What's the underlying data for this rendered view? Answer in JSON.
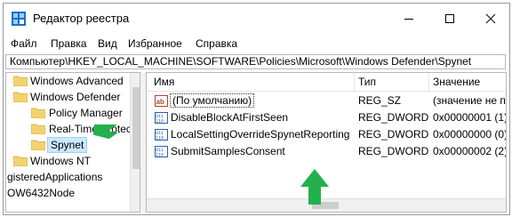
{
  "window": {
    "title": "Редактор реестра",
    "icon": "registry-editor-icon",
    "controls": [
      "minimize-icon",
      "maximize-icon",
      "close-icon"
    ]
  },
  "menu": [
    "Файл",
    "Правка",
    "Вид",
    "Избранное",
    "Справка"
  ],
  "address": "Компьютер\\HKEY_LOCAL_MACHINE\\SOFTWARE\\Policies\\Microsoft\\Windows Defender\\Spynet",
  "tree": [
    {
      "label": "Windows Advanced"
    },
    {
      "label": "Windows Defender"
    },
    {
      "label": "Policy Manager"
    },
    {
      "label": "Real-Time Protec"
    },
    {
      "label": "Spynet",
      "selected": true
    },
    {
      "label": "Windows NT"
    },
    {
      "label": "gisteredApplications"
    },
    {
      "label": "OW6432Node"
    }
  ],
  "list": {
    "columns": [
      "Имя",
      "Тип",
      "Значение"
    ],
    "rows": [
      {
        "name": "(По умолчанию)",
        "type": "REG_SZ",
        "value": "(значение не пр",
        "icon": "string-value-icon"
      },
      {
        "name": "DisableBlockAtFirstSeen",
        "type": "REG_DWORD",
        "value": "0x00000001 (1)",
        "icon": "dword-value-icon"
      },
      {
        "name": "LocalSettingOverrideSpynetReporting",
        "type": "REG_DWORD",
        "value": "0x00000000 (0)",
        "icon": "dword-value-icon"
      },
      {
        "name": "SubmitSamplesConsent",
        "type": "REG_DWORD",
        "value": "0x00000002 (2)",
        "icon": "dword-value-icon"
      }
    ]
  },
  "colors": {
    "arrow": "#22b14c",
    "folder": "#f3d371",
    "selection": "#cce8ff"
  }
}
